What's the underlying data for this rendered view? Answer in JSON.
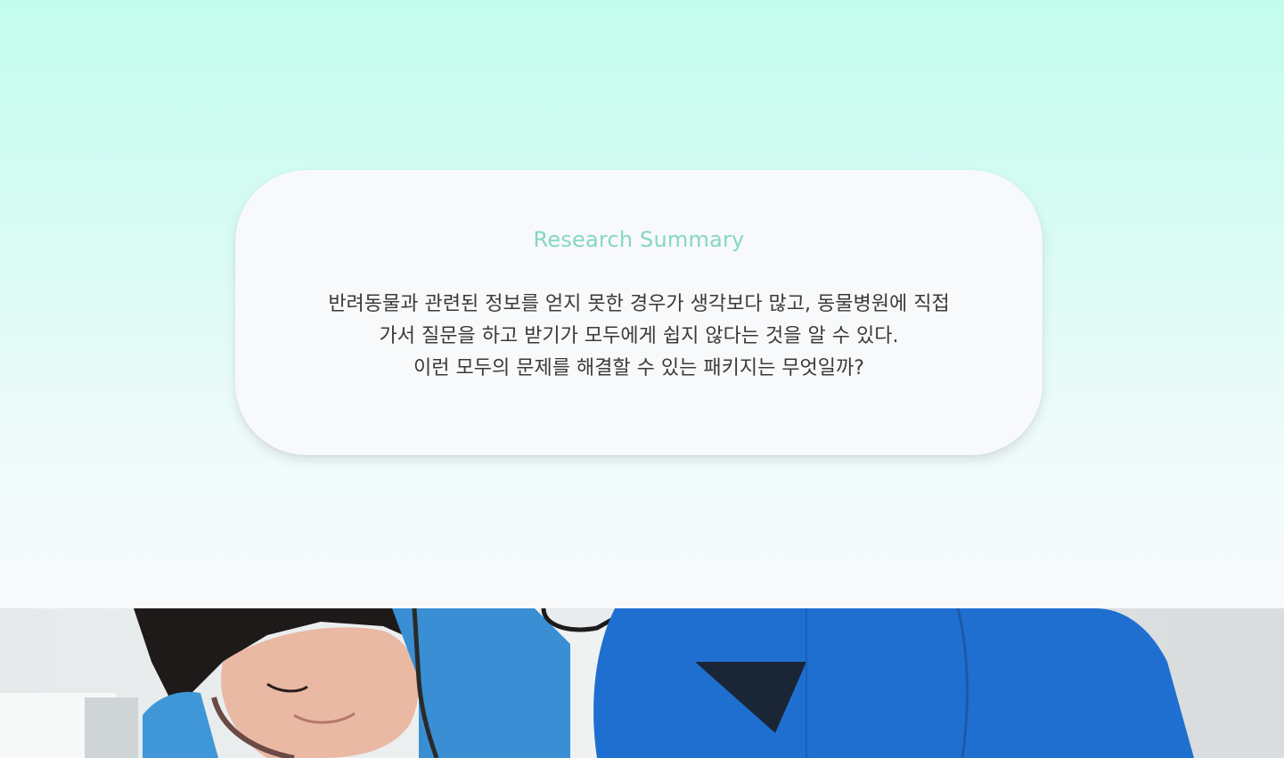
{
  "research": {
    "title": "Research Summary",
    "lines": [
      "반려동물과 관련된 정보를 얻지 못한 경우가 생각보다 많고, 동물병원에 직접",
      "가서 질문을 하고 받기가 모두에게 쉽지 않다는 것을 알 수 있다.",
      "이런 모두의 문제를 해결할 수 있는 패키지는 무엇일까?"
    ]
  },
  "colors": {
    "accent": "#84d7c3",
    "scrub_blue": "#1f6fd0",
    "scrub_light": "#3f97d8",
    "text": "#3a3a3a"
  },
  "photo": {
    "subject": "two veterinarians in blue scrubs with stethoscope"
  }
}
